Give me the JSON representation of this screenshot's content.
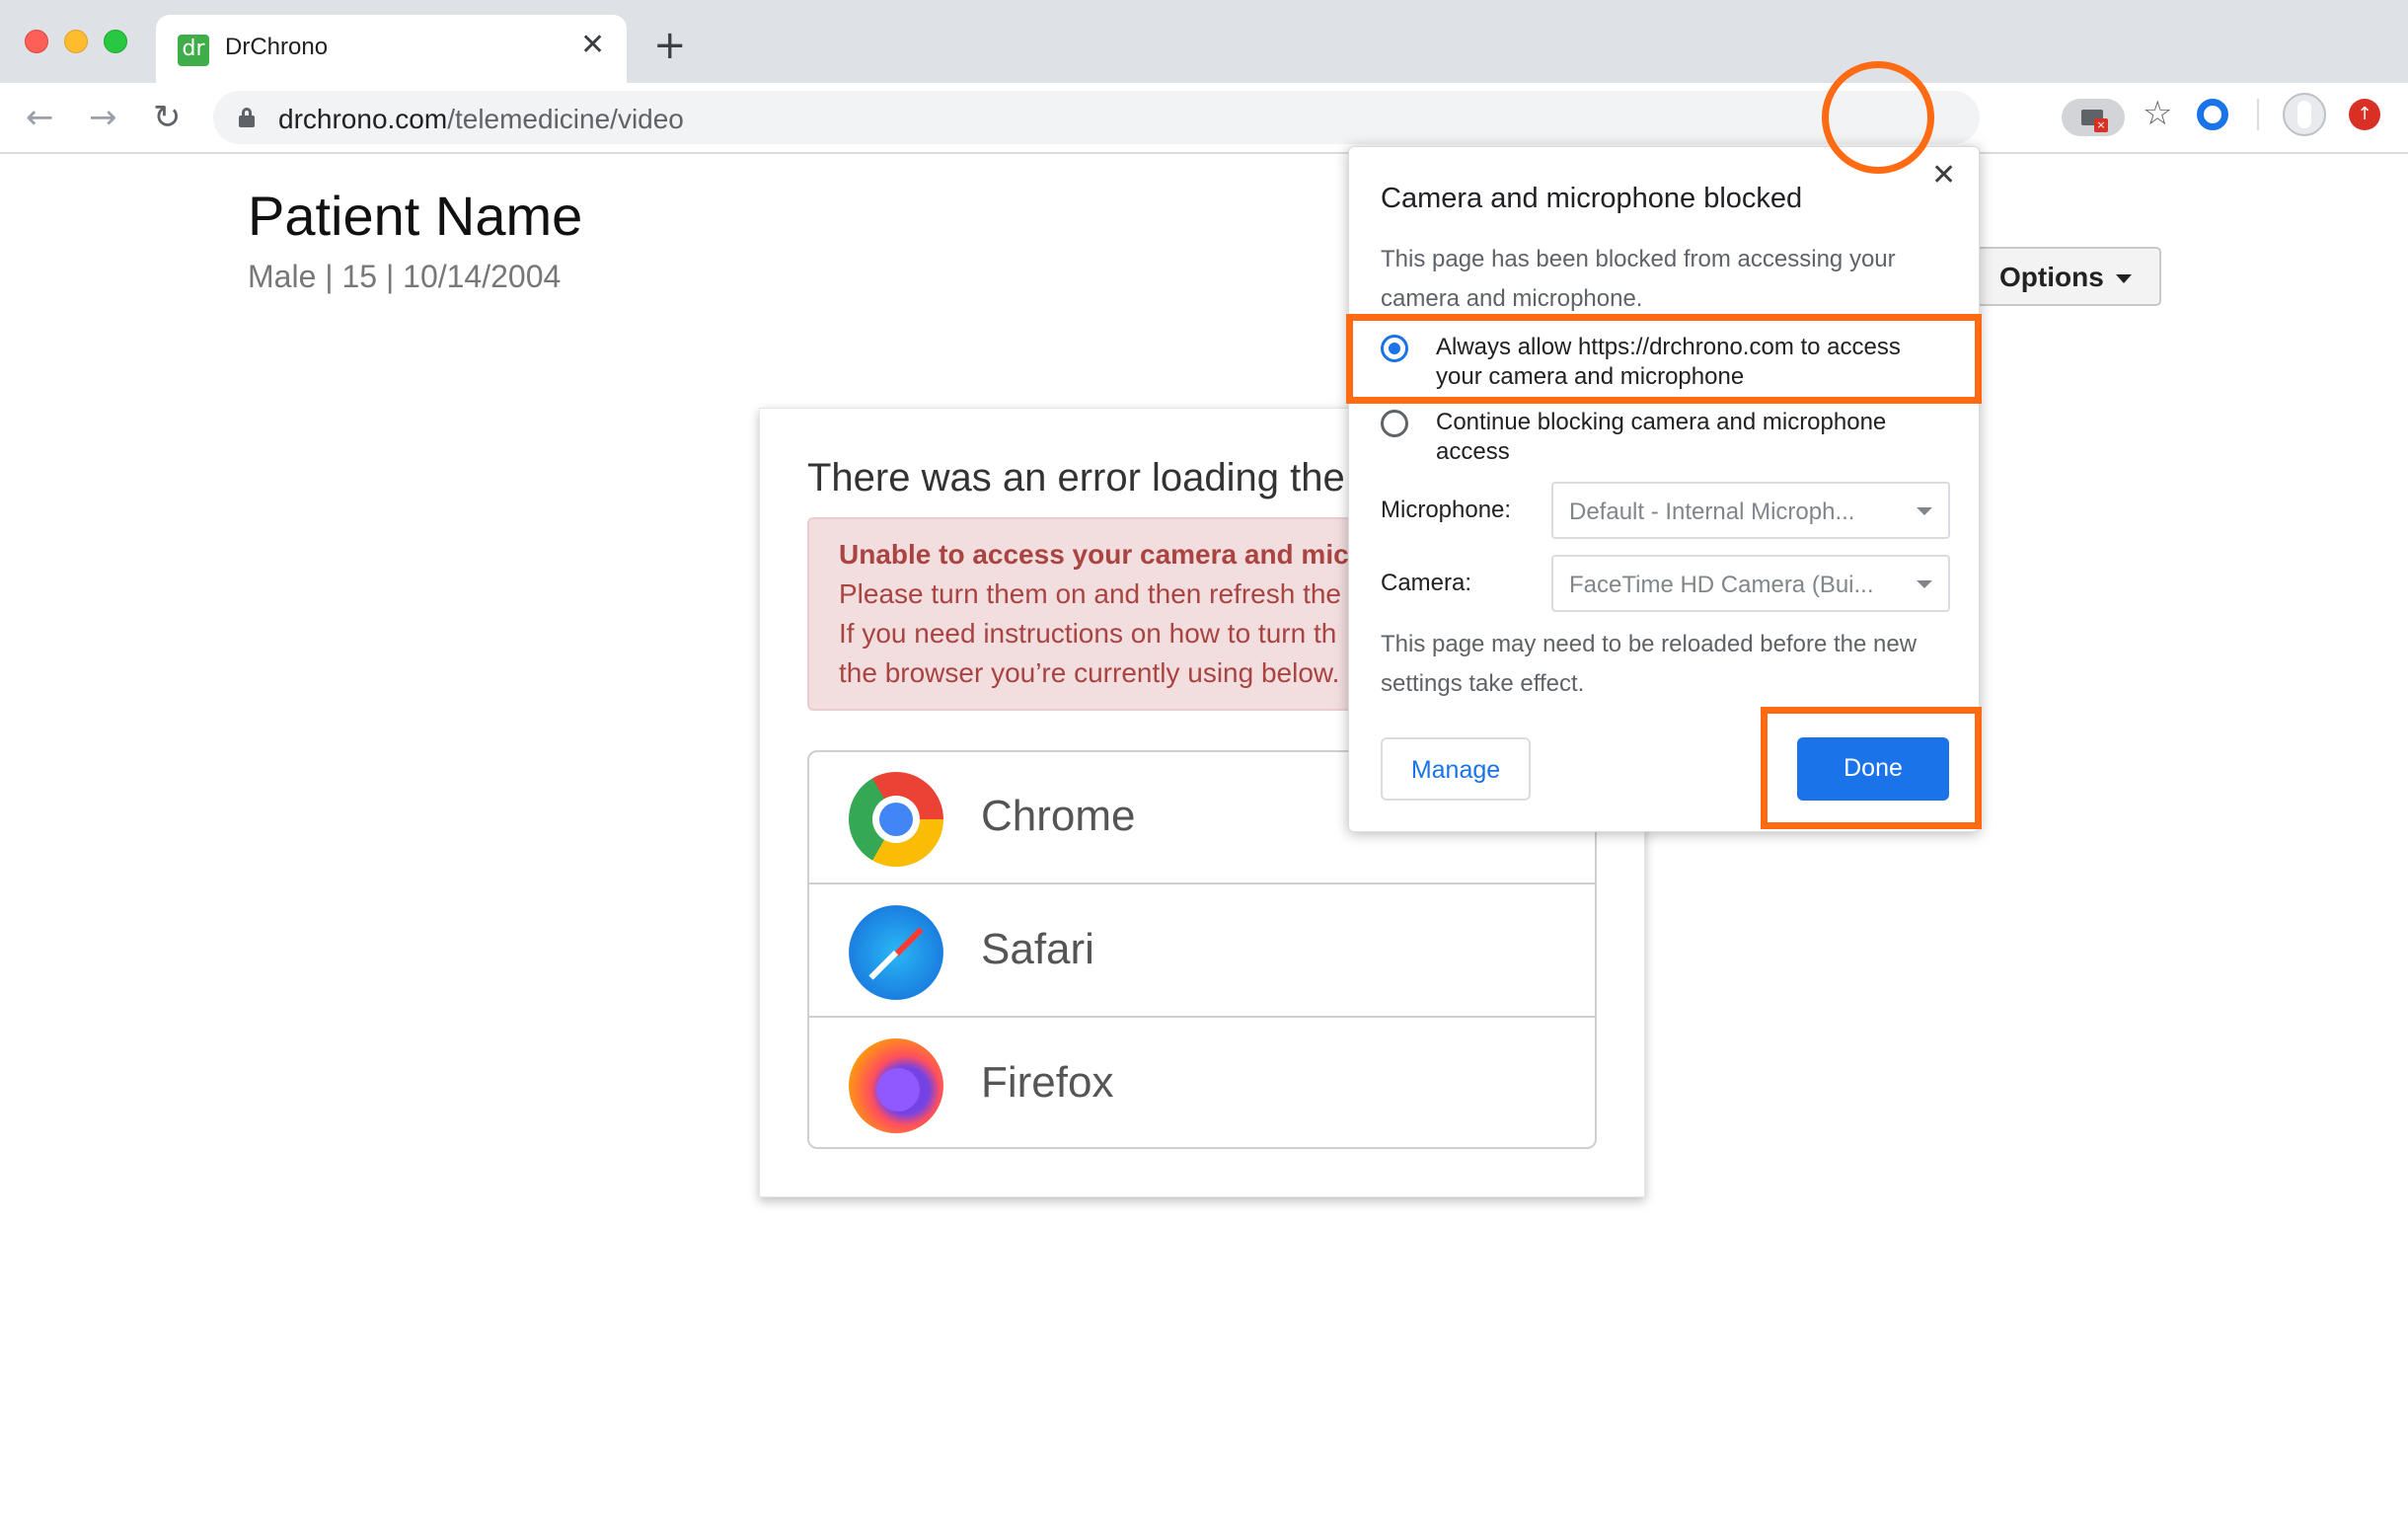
{
  "browser": {
    "tab": {
      "favicon_text": "dr",
      "title": "DrChrono",
      "close_glyph": "✕"
    },
    "new_tab_glyph": "+",
    "nav": {
      "back_glyph": "←",
      "forward_glyph": "→",
      "reload_glyph": "↻"
    },
    "url": {
      "domain": "drchrono.com",
      "path": "/telemedicine/video"
    },
    "star_glyph": "☆",
    "update_glyph": "↑",
    "icons": [
      "lock-icon",
      "camera-blocked-icon",
      "bookmark-star-icon",
      "extension-icon",
      "profile-icon",
      "update-icon"
    ]
  },
  "patient": {
    "name": "Patient Name",
    "meta": "Male | 15 | 10/14/2004"
  },
  "options_button": {
    "label": "Options"
  },
  "error_card": {
    "title": "There was an error loading the",
    "alert": {
      "strong": "Unable to access your camera and mic",
      "line1": "Please turn them on and then refresh the",
      "line2": "If you need instructions on how to turn th",
      "line3": "the browser you’re currently using below."
    },
    "browsers": [
      {
        "name": "Chrome",
        "icon": "chrome-logo"
      },
      {
        "name": "Safari",
        "icon": "safari-logo"
      },
      {
        "name": "Firefox",
        "icon": "firefox-logo"
      }
    ]
  },
  "popup": {
    "title": "Camera and microphone blocked",
    "close_glyph": "✕",
    "description": "This page has been blocked from accessing your camera and microphone.",
    "options": [
      {
        "label": "Always allow https://drchrono.com to access your camera and microphone",
        "selected": true
      },
      {
        "label": "Continue blocking camera and microphone access",
        "selected": false
      }
    ],
    "microphone": {
      "label": "Microphone:",
      "value": "Default - Internal Microph..."
    },
    "camera": {
      "label": "Camera:",
      "value": "FaceTime HD Camera (Bui..."
    },
    "reload_note": "This page may need to be reloaded before the new settings take effect.",
    "manage_label": "Manage",
    "done_label": "Done"
  },
  "colors": {
    "highlight": "#ff6a13",
    "accent_blue": "#1a73e8",
    "alert_text": "#a94442",
    "alert_bg": "#f2dede"
  }
}
